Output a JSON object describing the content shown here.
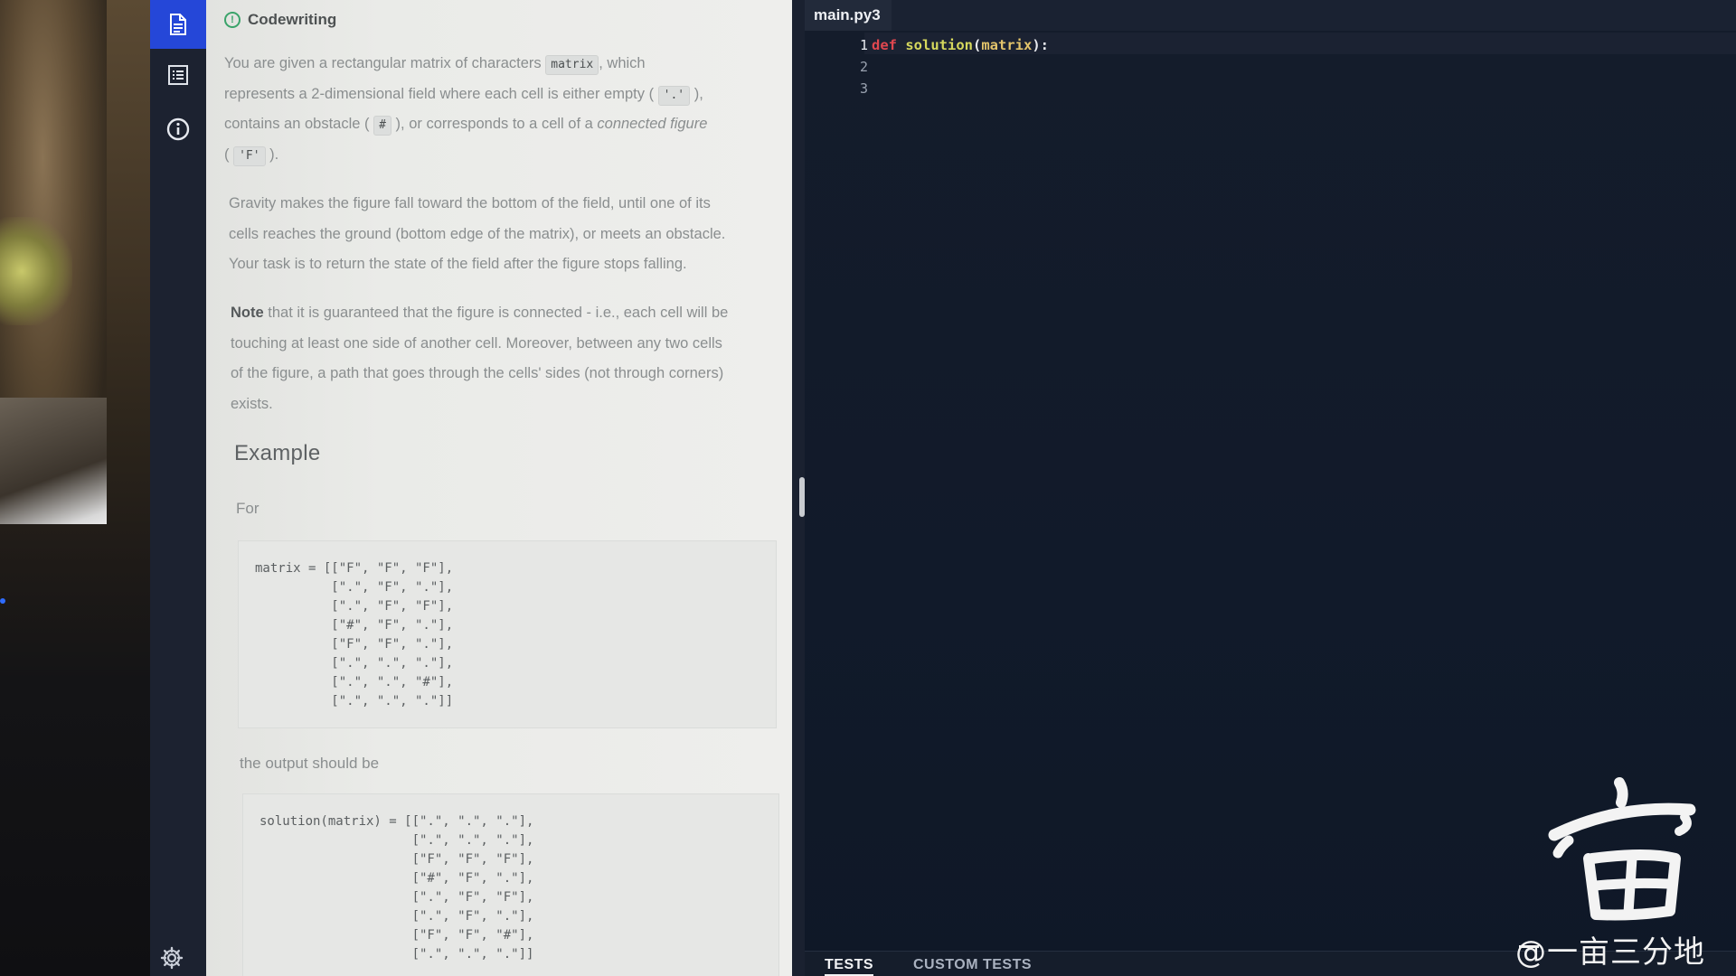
{
  "rail": {
    "icons": [
      "document-icon",
      "list-icon",
      "info-icon",
      "settings-icon"
    ]
  },
  "description": {
    "status_icon": "in-progress-icon",
    "title": "Codewriting",
    "p1": {
      "t1": "You are given a rectangular matrix of characters",
      "c1": "matrix",
      "t2": ", which",
      "t3": "represents a 2-dimensional field where each cell is either empty (",
      "c2": "'.'",
      "t4": "),",
      "t5": "contains an obstacle (",
      "c3": "#",
      "t6": "), or corresponds to a cell of a",
      "em": "connected figure",
      "t7": "(",
      "c4": "'F'",
      "t8": ")."
    },
    "p2": {
      "l1": "Gravity makes the figure fall toward the bottom of the field, until one of its",
      "l2": "cells reaches the ground (bottom edge of the matrix), or meets an obstacle.",
      "l3": "Your task is to return the state of the field after the figure stops falling."
    },
    "p3": {
      "bold": "Note",
      "l1": "that it is guaranteed that the figure is connected - i.e., each cell will be",
      "l2": "touching at least one side of another cell. Moreover, between any two cells",
      "l3": "of the figure, a path that goes through the cells' sides (not through corners)",
      "l4": "exists."
    },
    "example_heading": "Example",
    "for_label": "For",
    "input_code": "matrix = [[\"F\", \"F\", \"F\"],\n          [\".\", \"F\", \".\"],\n          [\".\", \"F\", \"F\"],\n          [\"#\", \"F\", \".\"],\n          [\"F\", \"F\", \".\"],\n          [\".\", \".\", \".\"],\n          [\".\", \".\", \"#\"],\n          [\".\", \".\", \".\"]]",
    "output_label": "the output should be",
    "output_code": "solution(matrix) = [[\".\", \".\", \".\"],\n                    [\".\", \".\", \".\"],\n                    [\"F\", \"F\", \"F\"],\n                    [\"#\", \"F\", \".\"],\n                    [\".\", \"F\", \"F\"],\n                    [\".\", \"F\", \".\"],\n                    [\"F\", \"F\", \"#\"],\n                    [\".\", \".\", \".\"]]"
  },
  "editor": {
    "tab": "main.py3",
    "line_numbers": [
      "1",
      "2",
      "3"
    ],
    "code": {
      "kw": "def",
      "fn": "solution",
      "open": "(",
      "param": "matrix",
      "close": "):"
    },
    "bottom_tabs": [
      "TESTS",
      "CUSTOM TESTS"
    ]
  },
  "watermark": {
    "text": "@一亩三分地"
  }
}
